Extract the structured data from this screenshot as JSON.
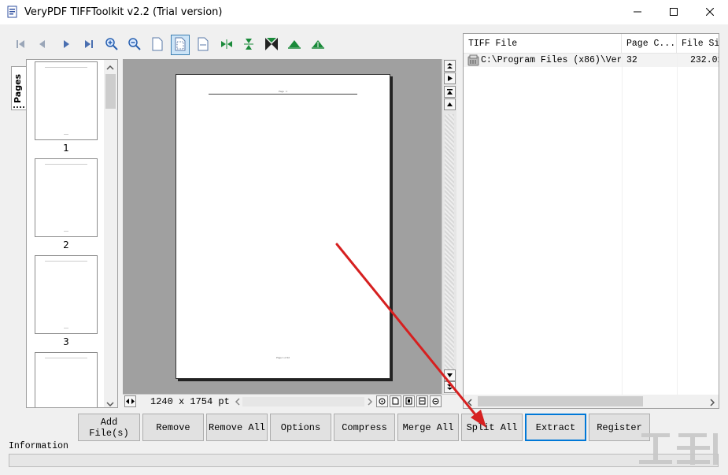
{
  "window": {
    "title": "VeryPDF TIFFToolkit v2.2 (Trial version)"
  },
  "toolbar": {
    "buttons": [
      "first-page",
      "previous-page",
      "next-page",
      "last-page",
      "zoom-in",
      "zoom-out",
      "fit-page",
      "actual-size",
      "fit-width",
      "flip-horizontal",
      "flip-vertical",
      "rotate",
      "rotate-left",
      "rotate-right"
    ]
  },
  "pages_tab": {
    "label": "Pages"
  },
  "thumbnails": [
    {
      "number": "1"
    },
    {
      "number": "2"
    },
    {
      "number": "3"
    },
    {
      "number": ""
    }
  ],
  "preview": {
    "header_text": "Page : 1",
    "footer_text": "Page 1 of 32",
    "dimensions": "1240 x 1754 pt"
  },
  "file_list": {
    "columns": [
      "TIFF File",
      "Page C...",
      "File Siz"
    ],
    "rows": [
      {
        "file": "C:\\Program Files (x86)\\Ver...",
        "pages": "32",
        "size": "232.01"
      }
    ]
  },
  "buttons": {
    "add_files": "Add File(s)",
    "remove": "Remove",
    "remove_all": "Remove All",
    "options": "Options",
    "compress": "Compress",
    "merge_all": "Merge All",
    "split_all": "Split All",
    "extract": "Extract",
    "register": "Register"
  },
  "info": {
    "label": "Information"
  },
  "colors": {
    "arrow": "#d62020",
    "accent": "#0078d7"
  }
}
